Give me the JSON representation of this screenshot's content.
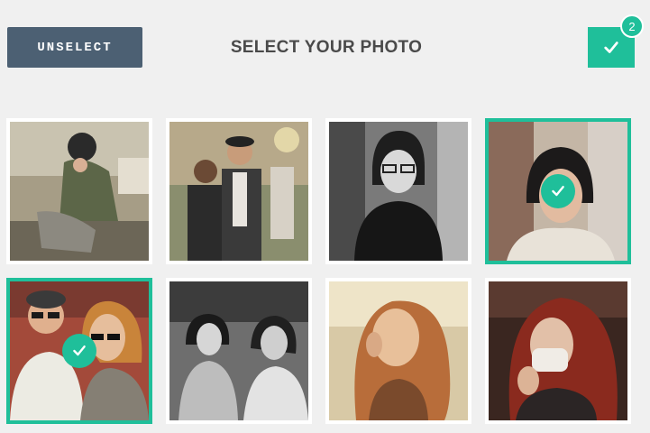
{
  "header": {
    "unselect_label": "UNSELECT",
    "title": "SELECT YOUR PHOTO",
    "selected_count": "2"
  },
  "colors": {
    "accent": "#1fbf9a",
    "button_dark": "#4c6073",
    "background": "#f0f0f0"
  },
  "photos": [
    {
      "subject": "person-crouching-fur-hat",
      "selected": false
    },
    {
      "subject": "two-men-street",
      "selected": false
    },
    {
      "subject": "woman-glasses-bw",
      "selected": false
    },
    {
      "subject": "woman-crowd",
      "selected": true
    },
    {
      "subject": "couple-sunglasses",
      "selected": true
    },
    {
      "subject": "women-crowd-bw",
      "selected": false
    },
    {
      "subject": "woman-red-hair",
      "selected": false
    },
    {
      "subject": "woman-red-hair-mask",
      "selected": false
    }
  ]
}
